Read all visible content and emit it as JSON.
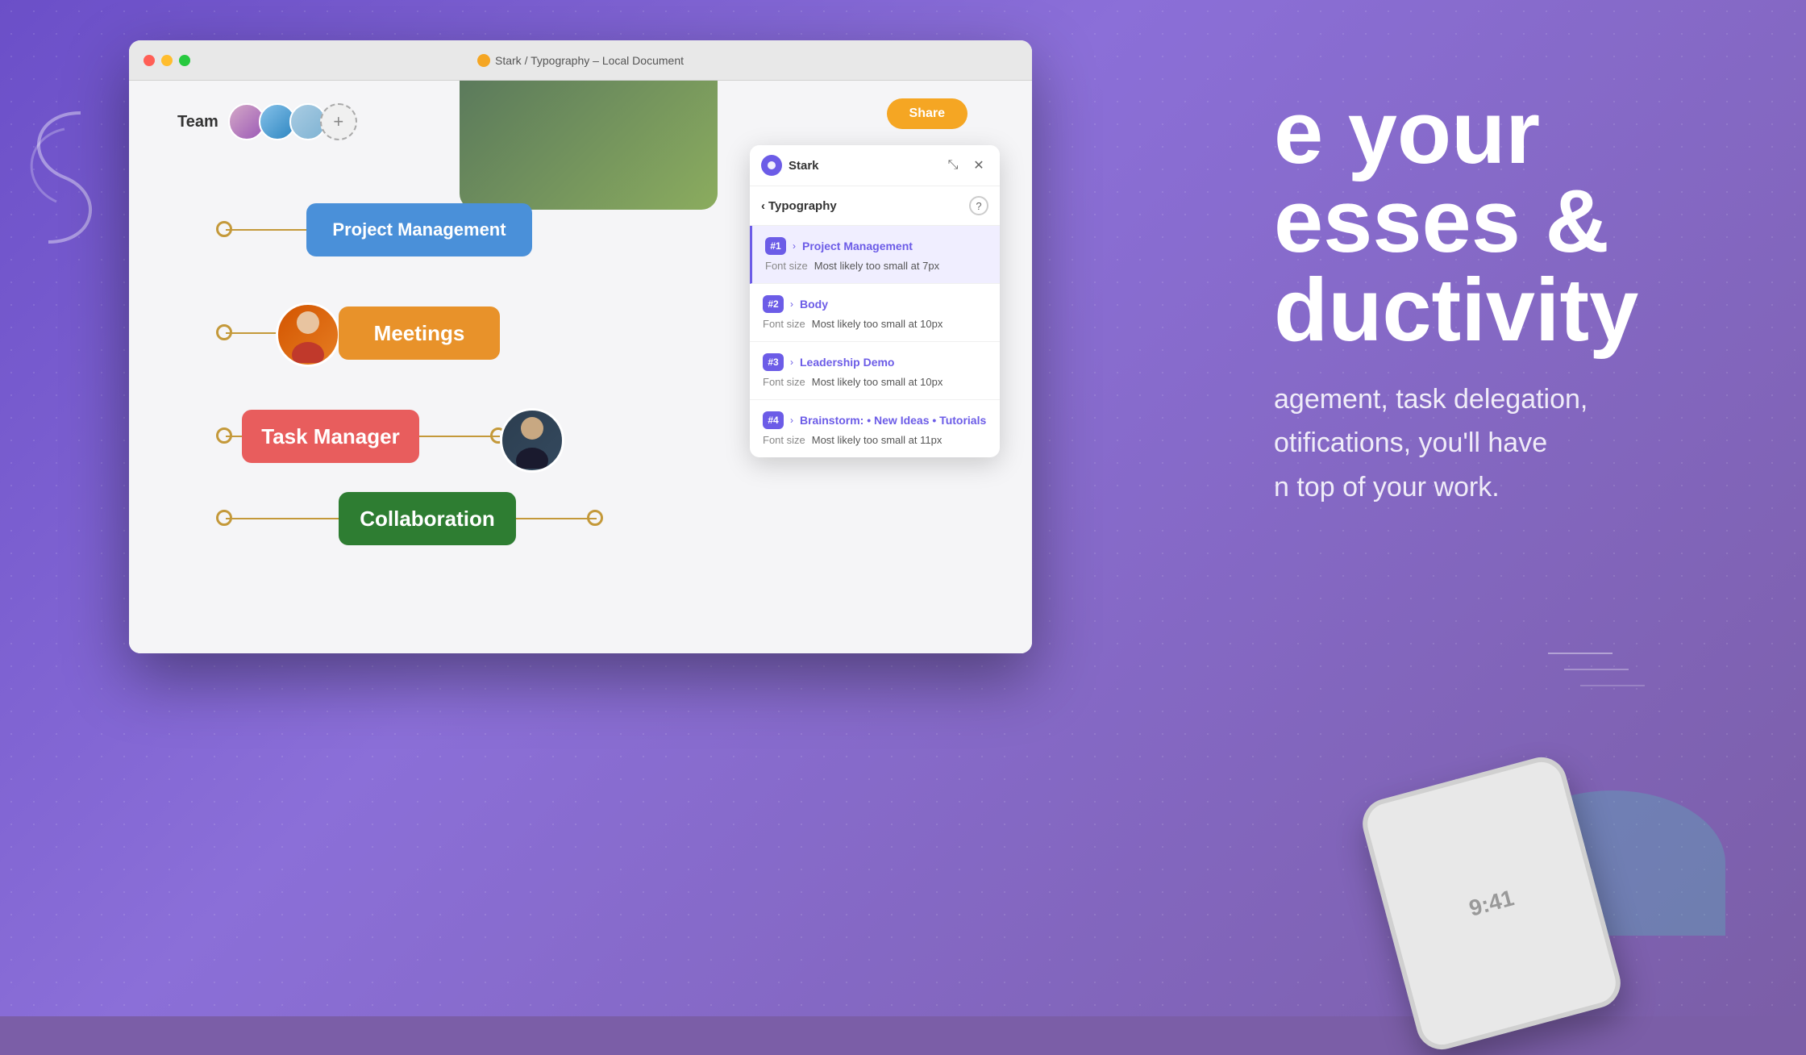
{
  "window": {
    "title": "Stark / Typography – Local Document",
    "title_icon": "star-icon"
  },
  "canvas": {
    "team_label": "Team",
    "top_button": "Share",
    "nodes": [
      {
        "id": "project",
        "label": "Project Management",
        "color": "#4A90D9"
      },
      {
        "id": "meetings",
        "label": "Meetings",
        "color": "#E8922A"
      },
      {
        "id": "task",
        "label": "Task Manager",
        "color": "#E85D5D"
      },
      {
        "id": "collab",
        "label": "Collaboration",
        "color": "#2E7D32"
      }
    ]
  },
  "stark_panel": {
    "logo_label": "Stark",
    "minimize_icon": "minimize-icon",
    "close_icon": "close-icon",
    "back_label": "Typography",
    "help_icon": "help-icon",
    "items": [
      {
        "num": "#1",
        "name": "Project Management",
        "font_size_label": "Font size",
        "font_size_value": "Most likely too small at 7px",
        "active": true
      },
      {
        "num": "#2",
        "name": "Body",
        "font_size_label": "Font size",
        "font_size_value": "Most likely too small at 10px",
        "active": false
      },
      {
        "num": "#3",
        "name": "Leadership Demo",
        "font_size_label": "Font size",
        "font_size_value": "Most likely too small at 10px",
        "active": false
      },
      {
        "num": "#4",
        "name": "Brainstorm: • New Ideas • Tutorials",
        "font_size_label": "Font size",
        "font_size_value": "Most likely too small at 11px",
        "active": false
      }
    ]
  },
  "right_content": {
    "headline_line1": "e your",
    "headline_line2": "esses &",
    "headline_line3": "ductivity",
    "subtext_line1": "agement, task delegation,",
    "subtext_line2": "otifications, you'll have",
    "subtext_line3": "n top of your work."
  },
  "phone": {
    "time": "9:41"
  },
  "colors": {
    "purple": "#7B5EA7",
    "accent_purple": "#6C5CE7",
    "node_blue": "#4A90D9",
    "node_orange": "#E8922A",
    "node_red": "#E85D5D",
    "node_green": "#2E7D32",
    "dot_gold": "#D4A843"
  }
}
